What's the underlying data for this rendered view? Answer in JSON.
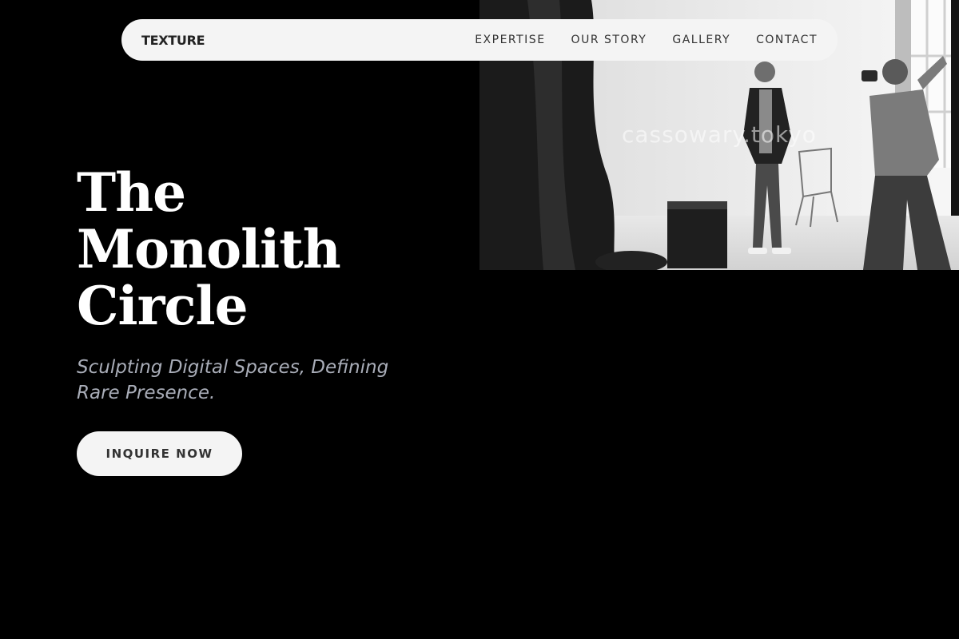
{
  "navbar": {
    "brand": "TEXTURE",
    "links": [
      {
        "label": "EXPERTISE"
      },
      {
        "label": "OUR STORY"
      },
      {
        "label": "GALLERY"
      },
      {
        "label": "CONTACT"
      }
    ]
  },
  "hero": {
    "title_lines": [
      "The",
      "Monolith",
      "Circle"
    ],
    "tagline": "Sculpting Digital Spaces, Defining Rare Presence.",
    "cta_label": "INQUIRE NOW",
    "photo_watermark": "cassowary.tokyo"
  },
  "colors": {
    "background": "#000000",
    "nav_background": "#f4f4f4",
    "title": "#ffffff",
    "tagline": "#a9adb8",
    "button_background": "#f4f4f4",
    "button_text": "#333333"
  }
}
